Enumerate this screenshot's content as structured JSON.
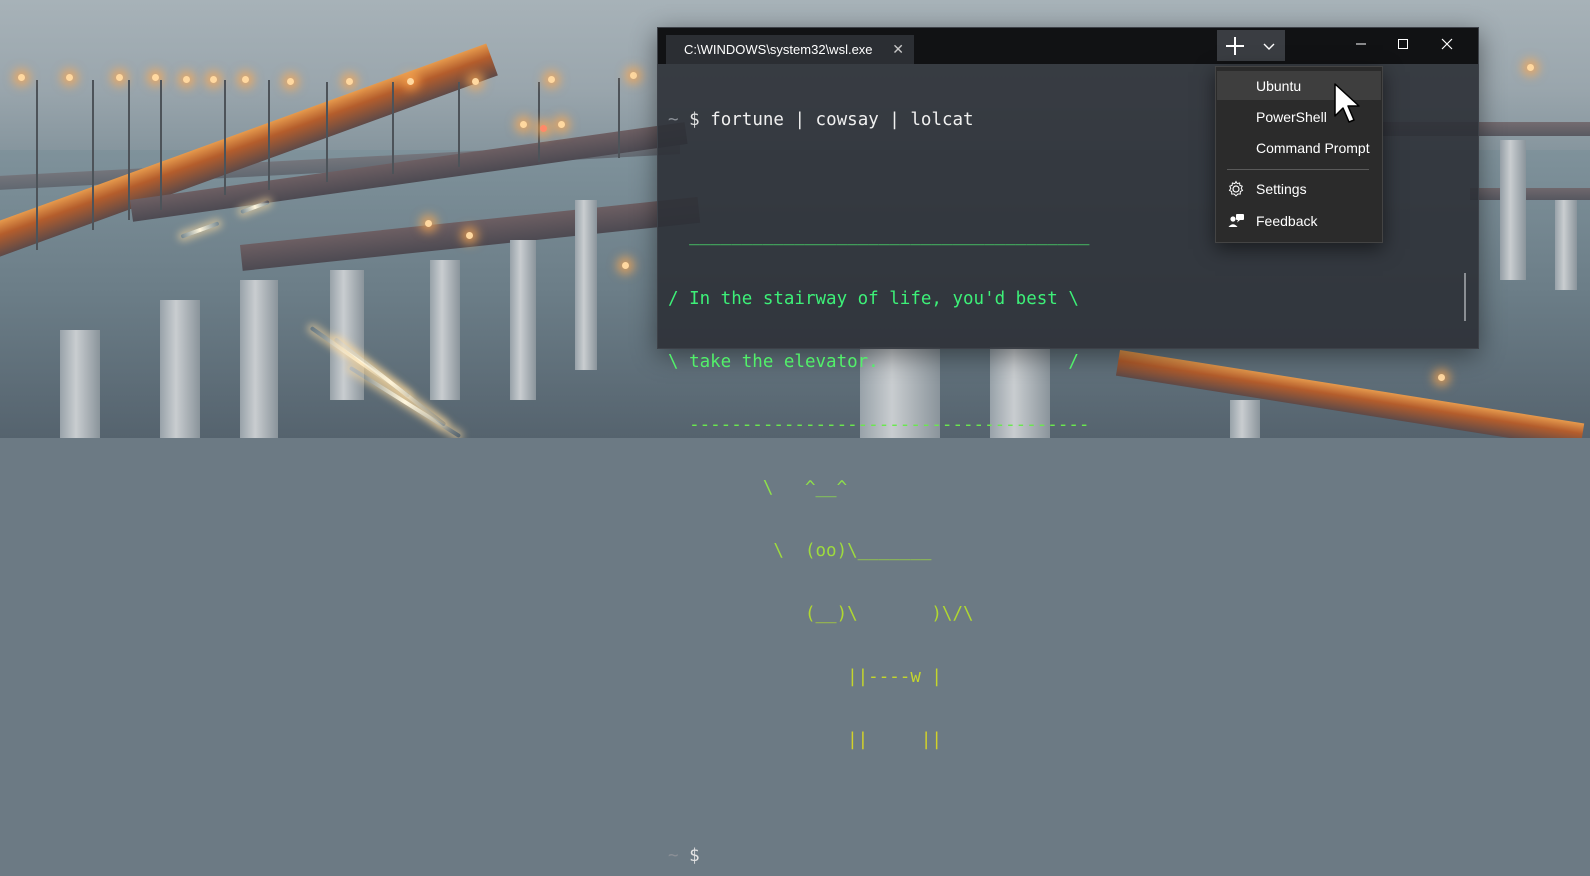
{
  "window": {
    "tab_title": "C:\\WINDOWS\\system32\\wsl.exe",
    "tab_close_icon": "close-icon",
    "new_tab_icon": "plus-icon",
    "dropdown_icon": "chevron-down-icon"
  },
  "terminal": {
    "prompt_symbol": "~",
    "prompt_dollar": "$",
    "command": "fortune | cowsay | lolcat",
    "output": [
      {
        "text": "  ______________________________________",
        "color": "#4ce86f"
      },
      {
        "text": "/ In the stairway of life, you'd best \\",
        "color": "#3df078"
      },
      {
        "text": "\\ take the elevator.                  /",
        "color": "#52f06a"
      },
      {
        "text": "  --------------------------------------",
        "color": "#6ae84e"
      },
      {
        "text": "         \\   ^__^",
        "color": "#8ee04a"
      },
      {
        "text": "          \\  (oo)\\_______",
        "color": "#9edb3e"
      },
      {
        "text": "             (__)\\       )\\/\\",
        "color": "#b0d830"
      },
      {
        "text": "                 ||----w |",
        "color": "#c4d62c"
      },
      {
        "text": "                 ||     ||",
        "color": "#d2d22a"
      }
    ]
  },
  "menu": {
    "items": [
      {
        "label": "Ubuntu"
      },
      {
        "label": "PowerShell"
      },
      {
        "label": "Command Prompt"
      }
    ],
    "settings_label": "Settings",
    "feedback_label": "Feedback"
  },
  "colors": {
    "titlebar": "#111214",
    "terminal_bg": "#2c3036",
    "menu_bg": "#2b2b2b",
    "menu_hover": "#3e3e3e"
  }
}
